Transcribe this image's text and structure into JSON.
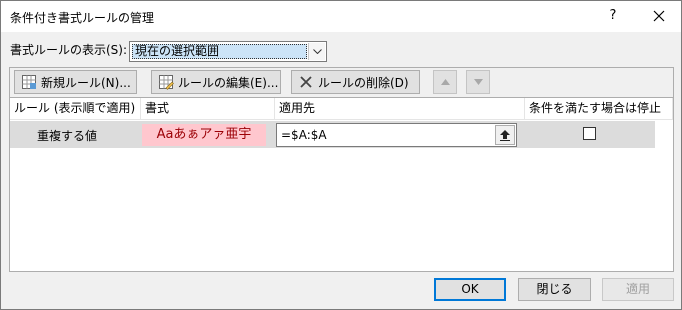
{
  "window": {
    "title": "条件付き書式ルールの管理",
    "help_label": "?"
  },
  "show_rules": {
    "label": "書式ルールの表示(S):",
    "selected": "現在の選択範囲"
  },
  "toolbar": {
    "new_rule": "新規ルール(N)...",
    "edit_rule": "ルールの編集(E)...",
    "delete_rule": "ルールの削除(D)",
    "move_up_icon": "triangle-up-icon",
    "move_down_icon": "triangle-down-icon"
  },
  "columns": [
    "ルール (表示順で適用)",
    "書式",
    "適用先",
    "条件を満たす場合は停止"
  ],
  "rules": [
    {
      "name": "重複する値",
      "format_preview": "Aaあぁアァ亜宇",
      "preview_fill": "#ffc7ce",
      "preview_text_color": "#9c0006",
      "applies_to": "=$A:$A",
      "stop_if_true": false
    }
  ],
  "buttons": {
    "ok": "OK",
    "close": "閉じる",
    "apply": "適用"
  },
  "colors": {
    "selection": "#cce4f7",
    "focus_border": "#0078d7"
  }
}
